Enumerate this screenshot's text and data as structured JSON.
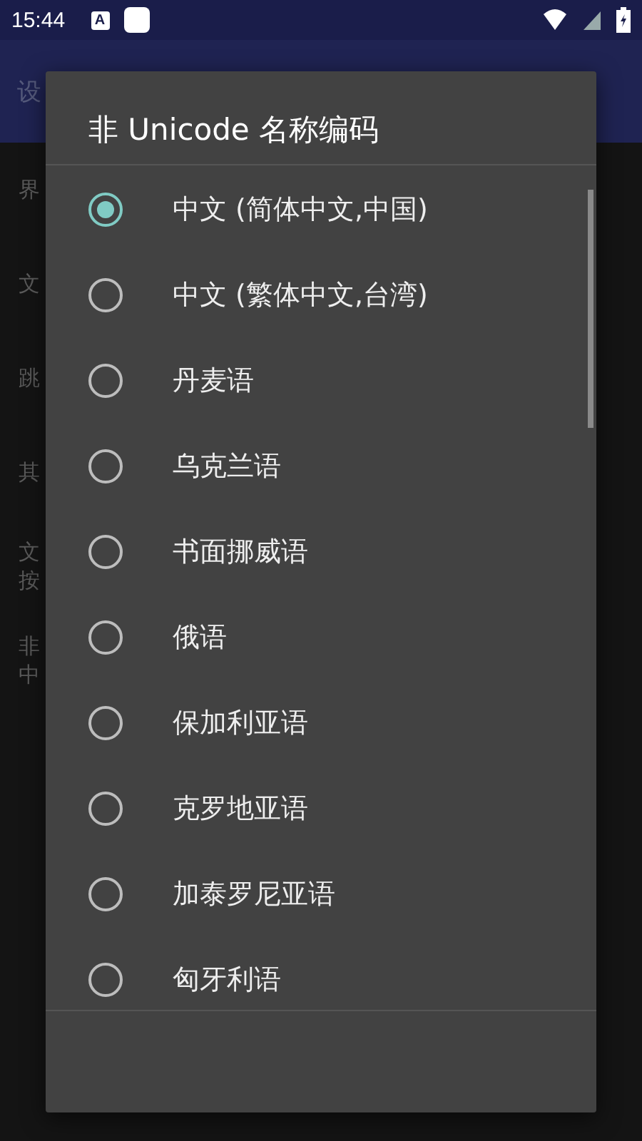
{
  "status_bar": {
    "time": "15:44",
    "notification_icons": [
      "A"
    ]
  },
  "app_bar": {
    "title": "设"
  },
  "background_items": [
    {
      "lines": [
        "界"
      ]
    },
    {
      "lines": [
        "文"
      ]
    },
    {
      "lines": [
        "跳"
      ]
    },
    {
      "lines": [
        "其"
      ]
    },
    {
      "lines": [
        "文",
        "按"
      ]
    },
    {
      "lines": [
        "非",
        "中"
      ]
    }
  ],
  "dialog": {
    "title": "非 Unicode 名称编码",
    "options": [
      {
        "label": "中文 (简体中文,中国)",
        "selected": true
      },
      {
        "label": "中文 (繁体中文,台湾)",
        "selected": false
      },
      {
        "label": "丹麦语",
        "selected": false
      },
      {
        "label": "乌克兰语",
        "selected": false
      },
      {
        "label": "书面挪威语",
        "selected": false
      },
      {
        "label": "俄语",
        "selected": false
      },
      {
        "label": "保加利亚语",
        "selected": false
      },
      {
        "label": "克罗地亚语",
        "selected": false
      },
      {
        "label": "加泰罗尼亚语",
        "selected": false
      },
      {
        "label": "匈牙利语",
        "selected": false
      }
    ]
  }
}
